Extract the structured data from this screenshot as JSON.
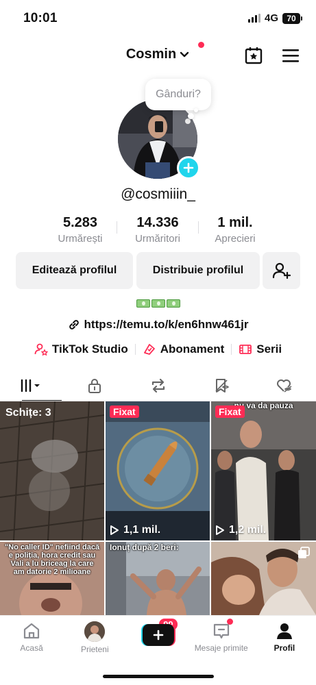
{
  "status_bar": {
    "time": "10:01",
    "network": "4G",
    "battery": "70"
  },
  "header": {
    "username": "Cosmin",
    "has_notification": true
  },
  "profile": {
    "thought_bubble": "Gânduri?",
    "handle": "@cosmiiin_",
    "stats": [
      {
        "value": "5.283",
        "label": "Urmărești"
      },
      {
        "value": "14.336",
        "label": "Urmăritori"
      },
      {
        "value": "1 mil.",
        "label": "Aprecieri"
      }
    ],
    "edit_button": "Editează profilul",
    "share_button": "Distribuie profilul",
    "bio_link": "https://temu.to/k/en6hnw461jr"
  },
  "features": [
    {
      "label": "TikTok Studio",
      "icon": "person-star-icon"
    },
    {
      "label": "Abonament",
      "icon": "subscription-icon"
    },
    {
      "label": "Serii",
      "icon": "series-icon"
    }
  ],
  "tabs": [
    {
      "name": "videos-grid-icon",
      "active": true
    },
    {
      "name": "lock-icon",
      "active": false
    },
    {
      "name": "repost-icon",
      "active": false
    },
    {
      "name": "favorites-icon",
      "active": false
    },
    {
      "name": "liked-icon",
      "active": false
    }
  ],
  "grid": {
    "drafts_label": "Schițe: 3",
    "pinned_label": "Fixat",
    "items": [
      {
        "views": "1,1 mil."
      },
      {
        "views": "1,2 mil.",
        "caption": "nu va da pauza"
      },
      {
        "caption": "\"No caller ID\" nefiind dacă e poliția, hora credit sau Vali a lu briceag la care am datorie 2 milioane"
      },
      {
        "caption": "Ionuț după 2 beri:"
      }
    ]
  },
  "nav": {
    "home": "Acasă",
    "friends": "Prieteni",
    "friends_badge": "99",
    "inbox": "Mesaje primite",
    "profile": "Profil"
  },
  "colors": {
    "accent": "#fe2c55",
    "cyan": "#20d5ec",
    "muted": "#8a8b91"
  }
}
